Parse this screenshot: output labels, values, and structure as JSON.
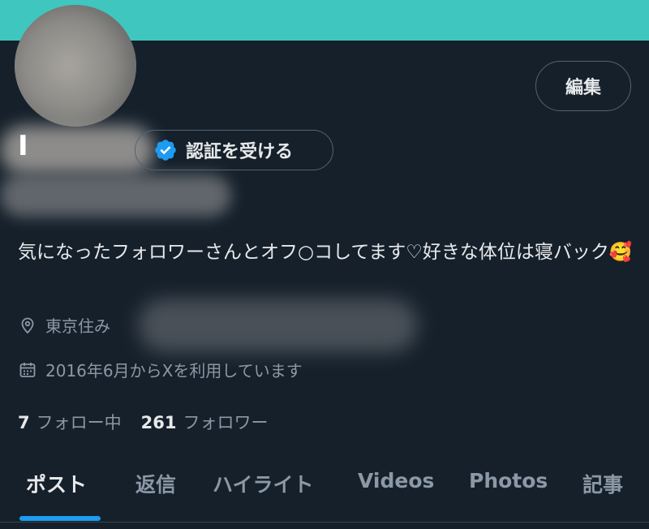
{
  "profile": {
    "edit_label": "編集",
    "name_visible_char": "I",
    "verify_label": "認証を受ける",
    "bio": "気になったフォロワーさんとオフ○コしてます♡好きな体位は寝バック🥰",
    "location": "東京住み",
    "joined": "2016年6月からXを利用しています",
    "following_count": "7",
    "following_label": "フォロー中",
    "followers_count": "261",
    "followers_label": "フォロワー"
  },
  "tabs": [
    "ポスト",
    "返信",
    "ハイライト",
    "Videos",
    "Photos",
    "記事"
  ],
  "colors": {
    "banner": "#3fc6bf",
    "background": "#15202b",
    "accent": "#1d9bf0",
    "verified": "#1d9bf0"
  },
  "icons": {
    "verify": "verified-badge-icon",
    "location": "location-pin-icon",
    "calendar": "calendar-icon"
  }
}
